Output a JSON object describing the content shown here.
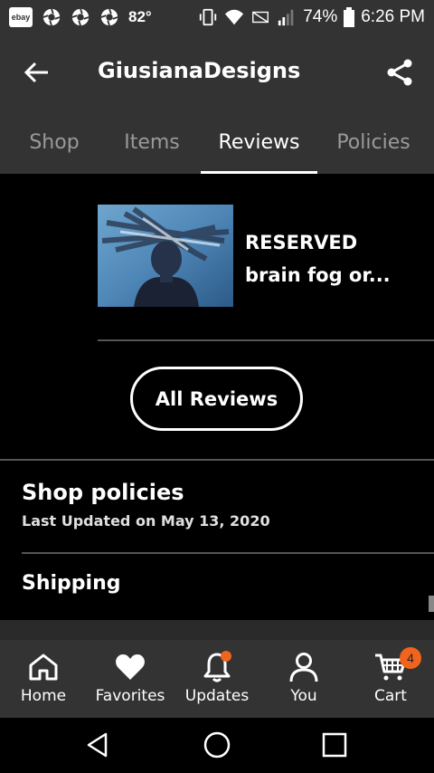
{
  "status_bar": {
    "ebay_label": "ebay",
    "temperature": "82°",
    "battery": "74%",
    "time": "6:26 PM"
  },
  "header": {
    "title": "GiusianaDesigns",
    "back_icon": "arrow-left-icon",
    "share_icon": "share-icon"
  },
  "tabs": [
    {
      "label": "Shop",
      "active": false
    },
    {
      "label": "Items",
      "active": false
    },
    {
      "label": "Reviews",
      "active": true
    },
    {
      "label": "Policies",
      "active": false
    }
  ],
  "review": {
    "title_line1": "RESERVED",
    "title_line2": "brain fog or..."
  },
  "all_reviews_label": "All Reviews",
  "policies": {
    "title": "Shop policies",
    "updated": "Last Updated on May 13, 2020",
    "shipping_label": "Shipping"
  },
  "bottom_nav": [
    {
      "label": "Home",
      "icon": "home-icon"
    },
    {
      "label": "Favorites",
      "icon": "heart-icon"
    },
    {
      "label": "Updates",
      "icon": "bell-icon"
    },
    {
      "label": "You",
      "icon": "user-icon"
    },
    {
      "label": "Cart",
      "icon": "cart-icon",
      "badge": "4"
    }
  ],
  "colors": {
    "bar_bg": "#333333",
    "accent": "#f1641e",
    "content_bg": "#000000"
  }
}
